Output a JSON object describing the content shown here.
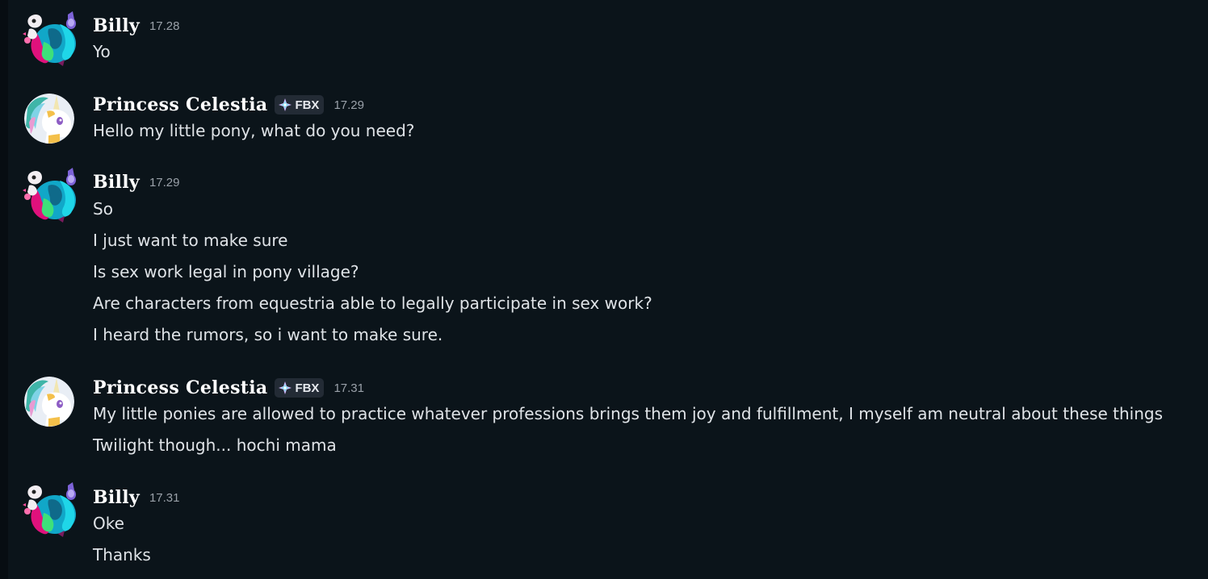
{
  "messages": [
    {
      "author": "Billy",
      "time": "17.28",
      "lines": [
        "Yo"
      ]
    },
    {
      "author": "Princess Celestia",
      "badge": "FBX",
      "time": "17.29",
      "lines": [
        "Hello my little pony, what do you need?"
      ]
    },
    {
      "author": "Billy",
      "time": "17.29",
      "lines": [
        "So",
        "I just want to make sure",
        "Is sex work legal in pony village?",
        "Are characters from equestria able to legally participate in sex work?",
        "I heard the rumors, so i want to make sure."
      ]
    },
    {
      "author": "Princess Celestia",
      "badge": "FBX",
      "time": "17.31",
      "lines": [
        "My little ponies are allowed to practice whatever professions brings them joy and fulfillment, I myself am neutral about these things",
        "Twilight though... hochi mama"
      ]
    },
    {
      "author": "Billy",
      "time": "17.31",
      "lines": [
        "Oke",
        "Thanks"
      ]
    }
  ],
  "colors": {
    "background": "#0b141a",
    "text": "#dfe3e7",
    "author": "#ffffff",
    "timestamp": "#9aa1a9",
    "badge_bg": "#232b35"
  },
  "icons": {
    "billy_avatar": "pony-sticker-avatar",
    "celestia_avatar": "white-pony-avatar",
    "badge_icon": "sparkle-diamond-icon"
  }
}
